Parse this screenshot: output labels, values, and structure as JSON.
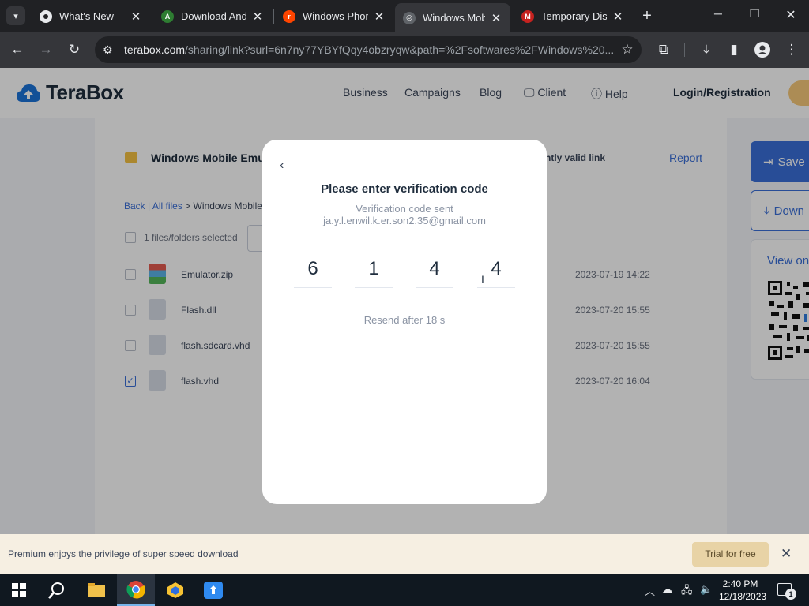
{
  "browser": {
    "tabs": [
      {
        "title": "What's New",
        "favicon": "chrome-icon",
        "active": false
      },
      {
        "title": "Download And",
        "favicon": "android-icon",
        "active": false
      },
      {
        "title": "Windows Phon",
        "favicon": "reddit-icon",
        "active": false
      },
      {
        "title": "Windows Mobi",
        "favicon": "globe-icon",
        "active": true
      },
      {
        "title": "Temporary Disp",
        "favicon": "gmail-icon",
        "active": false
      }
    ],
    "url_host": "terabox.com",
    "url_rest": "/sharing/link?surl=6n7ny77YBYfQqy4obzryqw&path=%2Fsoftwares%2FWindows%20..."
  },
  "site": {
    "brand": "TeraBox",
    "nav": {
      "business": "Business",
      "campaigns": "Campaigns",
      "blog": "Blog",
      "client": "Client",
      "help": "Help",
      "login": "Login/Registration"
    }
  },
  "share": {
    "folder_title": "Windows Mobile Emul",
    "valid_note": "ntly valid link",
    "report": "Report",
    "breadcrumb": {
      "back": "Back",
      "sep": "|",
      "all_files": "All files",
      "arrow": ">",
      "current": "Windows Mobile"
    },
    "selection": "1 files/folders selected",
    "files": [
      {
        "name": "Emulator.zip",
        "date": "2023-07-19 14:22",
        "checked": false,
        "type": "zip"
      },
      {
        "name": "Flash.dll",
        "date": "2023-07-20 15:55",
        "checked": false,
        "type": "file"
      },
      {
        "name": "flash.sdcard.vhd",
        "date": "2023-07-20 15:55",
        "checked": false,
        "type": "file"
      },
      {
        "name": "flash.vhd",
        "date": "2023-07-20 16:04",
        "checked": true,
        "type": "file"
      }
    ],
    "side": {
      "save": "Save",
      "download": "Down",
      "view_on": "View on"
    }
  },
  "modal": {
    "back_glyph": "‹",
    "title": "Please enter verification code",
    "sent_label": "Verification code sent",
    "email": "ja.y.l.enwil.k.er.son2.35@gmail.com",
    "digits": [
      "6",
      "1",
      "4",
      "4"
    ],
    "resend": "Resend after 18 s"
  },
  "premium": {
    "text": "Premium enjoys the privilege of super speed download",
    "trial": "Trial for free"
  },
  "taskbar": {
    "time": "2:40 PM",
    "date": "12/18/2023",
    "notification_count": "1"
  },
  "colors": {
    "accent": "#3a6fd8",
    "chrome_dark": "#202124",
    "chrome_toolbar": "#35363a",
    "premium_bg": "#f6efe2"
  }
}
